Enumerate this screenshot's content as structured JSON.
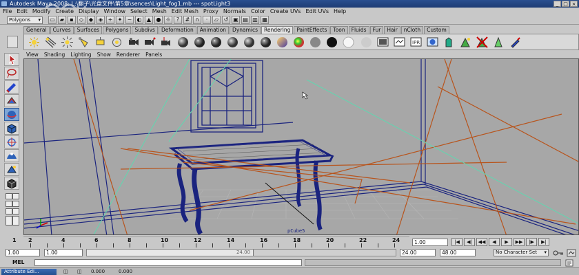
{
  "window": {
    "title": "Autodesk Maya 2008: L:\\翻子\\光盘文件\\第5章\\sences\\Light_fog1.mb  ---  spotLight3"
  },
  "menubar": {
    "items": [
      "File",
      "Edit",
      "Modify",
      "Create",
      "Display",
      "Window",
      "Select",
      "Mesh",
      "Edit Mesh",
      "Proxy",
      "Normals",
      "Color",
      "Create UVs",
      "Edit UVs",
      "Help"
    ]
  },
  "statusline": {
    "mode": "Polygons"
  },
  "shelf": {
    "tabs": [
      "General",
      "Curves",
      "Surfaces",
      "Polygons",
      "Subdivs",
      "Deformation",
      "Animation",
      "Dynamics",
      "Rendering",
      "PaintEffects",
      "Toon",
      "Fluids",
      "Fur",
      "Hair",
      "nCloth",
      "Custom"
    ],
    "active_tab": "Rendering"
  },
  "panel": {
    "menus": [
      "View",
      "Shading",
      "Lighting",
      "Show",
      "Renderer",
      "Panels"
    ],
    "selected_object": "pCube5"
  },
  "timeslider": {
    "ticks": [
      "2",
      "4",
      "6",
      "8",
      "10",
      "12",
      "14",
      "16",
      "18",
      "20",
      "22",
      "24"
    ],
    "start_label": "1",
    "current_frame": "1.00"
  },
  "rangeslider": {
    "start_time": "1.00",
    "playback_start": "1.00",
    "range_label": "24.00",
    "playback_end": "24.00",
    "end_time": "48.00",
    "character_set": "No Character Set"
  },
  "commandline": {
    "label": "MEL"
  },
  "taskbar": {
    "attribute_editor": "Attribute Edi...",
    "coord_x": "0.000",
    "coord_y": "0.000"
  },
  "colors": {
    "viewport_bg": "#a7a7a7",
    "wire_blue": "#1a237e",
    "light_orange": "#b8541c",
    "light_cyan": "#5fd8b0",
    "selection_active": "#7ea6d6"
  }
}
